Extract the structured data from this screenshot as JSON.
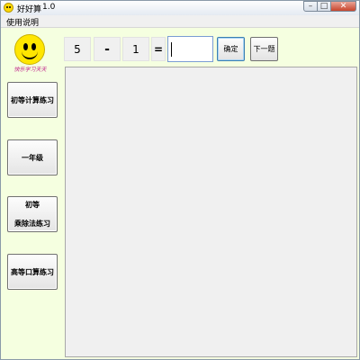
{
  "window": {
    "title": "好好算",
    "version": "1.0",
    "controls": {
      "minimize": "–",
      "maximize": "□",
      "close": "✕"
    }
  },
  "menu": {
    "items": [
      "使用说明"
    ]
  },
  "logo": {
    "icon": "smiley-face-icon",
    "tagline": "快乐学习天天"
  },
  "side_buttons": [
    {
      "label": "初等计算练习"
    },
    {
      "label": "一年级"
    },
    {
      "label_line1": "初等",
      "label_line2": "乘除法练习"
    },
    {
      "label": "高等口算练习"
    }
  ],
  "equation": {
    "operand_a": "5",
    "operator": "-",
    "operand_b": "1",
    "equals": "=",
    "answer": ""
  },
  "buttons": {
    "confirm": "确定",
    "next": "下一题"
  },
  "colors": {
    "window_bg": "#f5ffe0",
    "result_area_bg": "#f0f0f0",
    "smiley": "#ffe600",
    "tagline": "#c0208a"
  }
}
